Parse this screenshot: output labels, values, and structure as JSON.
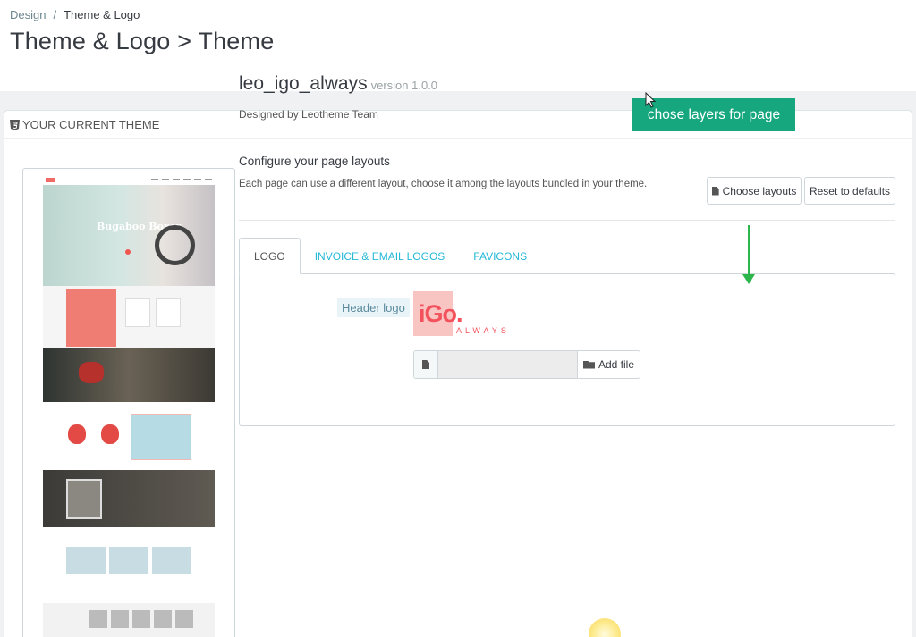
{
  "breadcrumb": {
    "parent": "Design",
    "separator": "/",
    "current": "Theme & Logo"
  },
  "page": {
    "title": "Theme & Logo > Theme"
  },
  "panel": {
    "heading": "YOUR CURRENT THEME"
  },
  "theme": {
    "name": "leo_igo_always",
    "version": "version 1.0.0",
    "designed_by": "Designed by Leotheme Team"
  },
  "preview": {
    "hero_title": "Bugaboo Boxer"
  },
  "layouts": {
    "title": "Configure your page layouts",
    "description": "Each page can use a different layout, choose it among the layouts bundled in your theme.",
    "choose_label": "Choose layouts",
    "reset_label": "Reset to defaults"
  },
  "tabs": [
    {
      "label": "LOGO",
      "active": true
    },
    {
      "label": "INVOICE & EMAIL LOGOS",
      "active": false
    },
    {
      "label": "FAVICONS",
      "active": false
    }
  ],
  "logo_tab": {
    "header_logo_label": "Header logo",
    "logo_text": "iGo.",
    "logo_sub": "ALWAYS",
    "add_file_label": "Add file",
    "file_value": ""
  },
  "annotation": {
    "text": "chose layers for page"
  },
  "colors": {
    "accent": "#25b9d7",
    "annotation_bg": "#16a77f",
    "arrow": "#2cb54a",
    "logo_pink": "#f3515b"
  }
}
